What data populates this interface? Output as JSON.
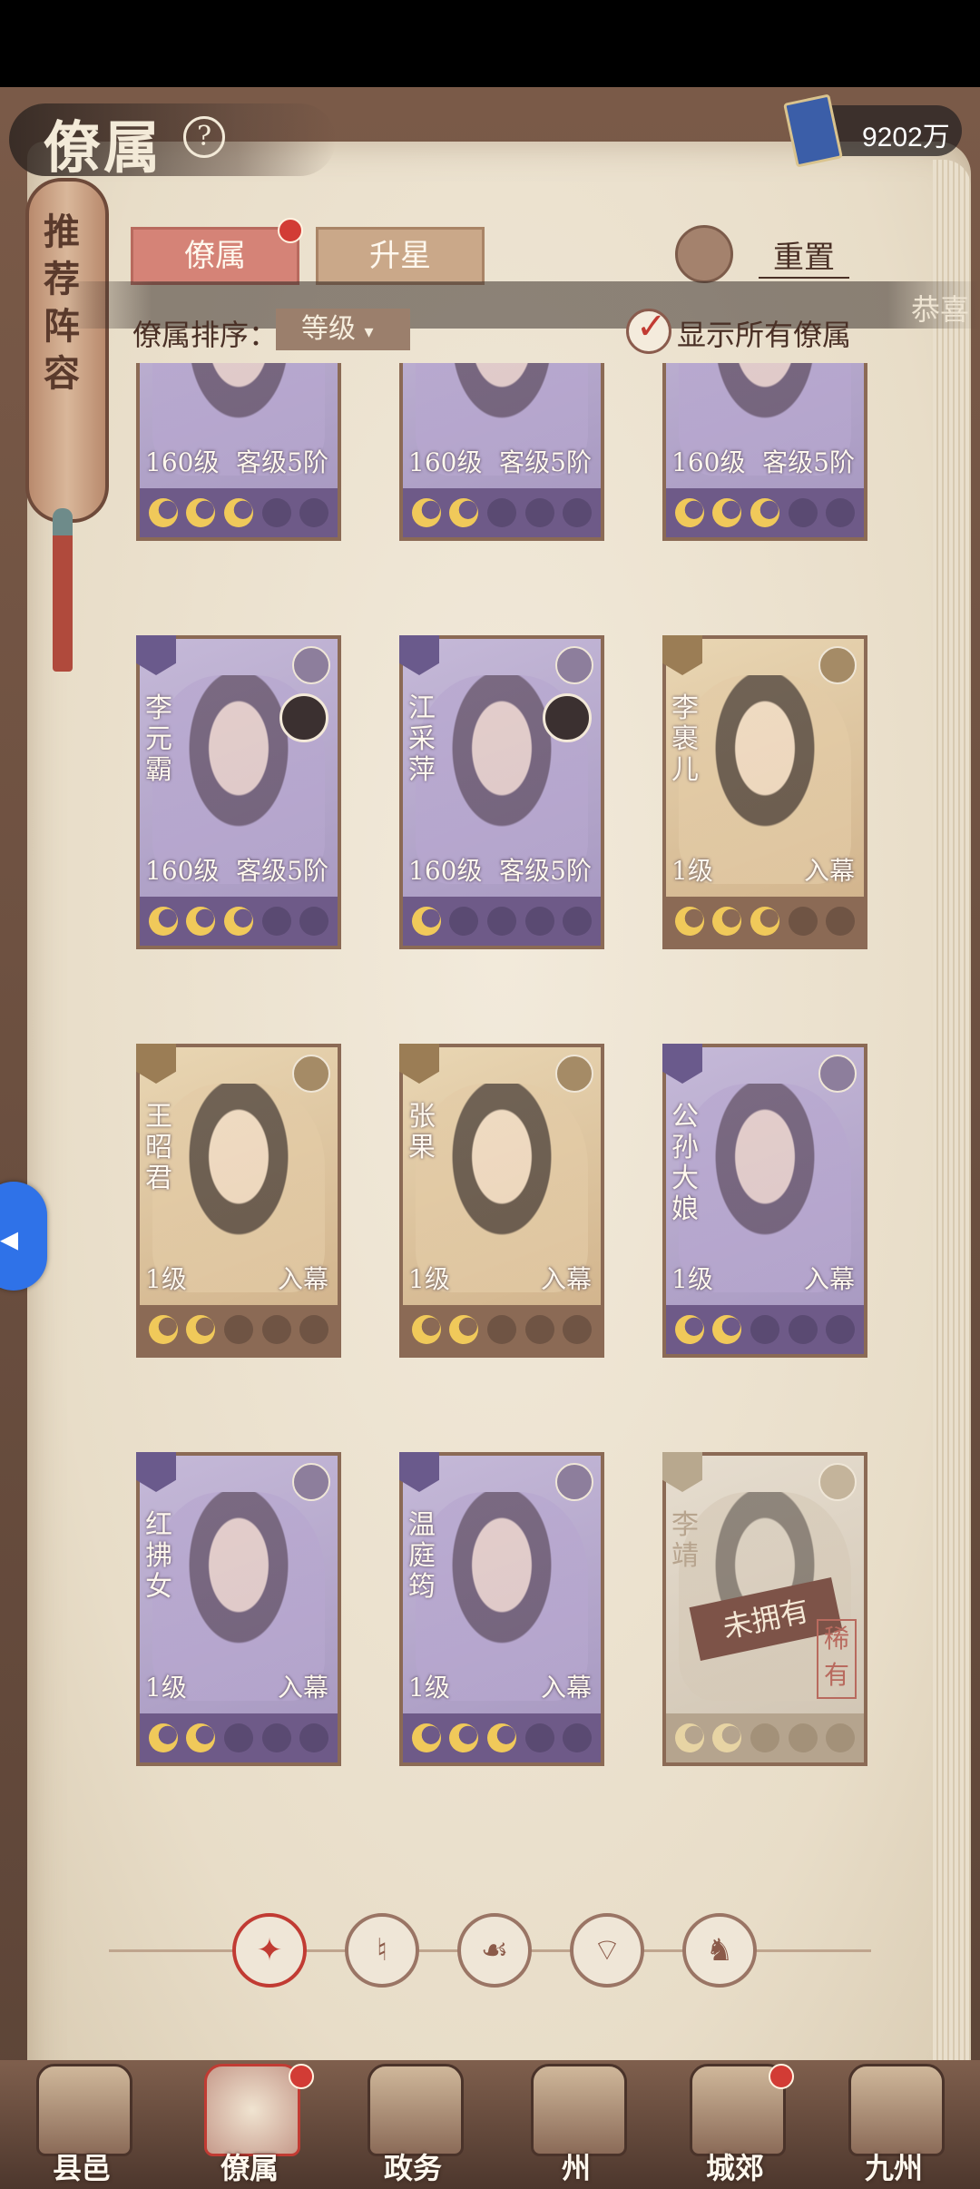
{
  "header": {
    "title": "僚属",
    "help_icon": "?",
    "currency": "9202万"
  },
  "side_scroll": {
    "text": "推荐阵容"
  },
  "tabs": {
    "primary": "僚属",
    "secondary": "升星"
  },
  "reset": {
    "label": "重置"
  },
  "notice": {
    "text": "恭喜"
  },
  "sort": {
    "label": "僚属排序：",
    "value": "等级"
  },
  "show_all": {
    "label": "显示所有僚属",
    "checked": true
  },
  "cards": [
    {
      "name": "",
      "level": "160级",
      "rank": "客级5阶",
      "stars": 3,
      "style": "purple"
    },
    {
      "name": "",
      "level": "160级",
      "rank": "客级5阶",
      "stars": 2,
      "style": "purple"
    },
    {
      "name": "",
      "level": "160级",
      "rank": "客级5阶",
      "stars": 3,
      "style": "purple"
    },
    {
      "name": "李元霸",
      "level": "160级",
      "rank": "客级5阶",
      "stars": 3,
      "style": "purple"
    },
    {
      "name": "江采萍",
      "level": "160级",
      "rank": "客级5阶",
      "stars": 1,
      "style": "purple"
    },
    {
      "name": "李裹儿",
      "level": "1级",
      "rank": "入幕",
      "stars": 3,
      "style": "gold"
    },
    {
      "name": "王昭君",
      "level": "1级",
      "rank": "入幕",
      "stars": 2,
      "style": "gold"
    },
    {
      "name": "张果",
      "level": "1级",
      "rank": "入幕",
      "stars": 2,
      "style": "gold"
    },
    {
      "name": "公孙大娘",
      "level": "1级",
      "rank": "入幕",
      "stars": 2,
      "style": "purple"
    },
    {
      "name": "红拂女",
      "level": "1级",
      "rank": "入幕",
      "stars": 2,
      "style": "purple"
    },
    {
      "name": "温庭筠",
      "level": "1级",
      "rank": "入幕",
      "stars": 3,
      "style": "purple"
    },
    {
      "name": "李靖",
      "level": "",
      "rank": "",
      "stars": 2,
      "style": "grey",
      "unowned_label": "未拥有",
      "rare_label": "稀有"
    }
  ],
  "filters": [
    "diamond-icon",
    "bell-icon",
    "cat-icon",
    "fan-icon",
    "beast-icon"
  ],
  "nav": [
    {
      "label": "县邑",
      "badge": false
    },
    {
      "label": "僚属",
      "badge": true,
      "active": true
    },
    {
      "label": "政务",
      "badge": false
    },
    {
      "label": "州",
      "badge": false
    },
    {
      "label": "城郊",
      "badge": true
    },
    {
      "label": "九州",
      "badge": false
    }
  ],
  "colors": {
    "accent_red": "#c13b33",
    "tab_active": "#d58377",
    "card_purple": "#a596bf",
    "card_gold": "#cfb088"
  }
}
